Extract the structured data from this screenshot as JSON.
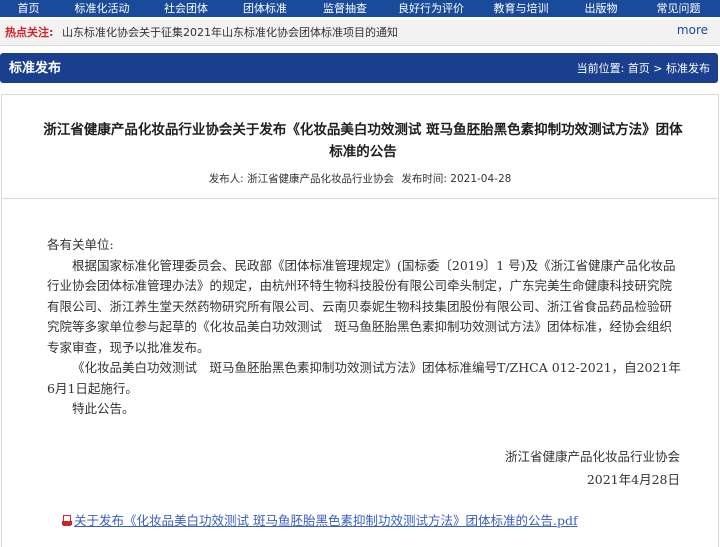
{
  "nav": [
    "首页",
    "标准化活动",
    "社会团体",
    "团体标准",
    "监督抽查",
    "良好行为评价",
    "教育与培训",
    "出版物",
    "常见问题"
  ],
  "hot": {
    "label": "热点关注:",
    "text": "山东标准化协会关于征集2021年山东标准化协会团体标准项目的通知",
    "more": "more"
  },
  "section": {
    "title": "标准发布",
    "breadcrumb": "当前位置: 首页 > 标准发布"
  },
  "article": {
    "title": "浙江省健康产品化妆品行业协会关于发布《化妆品美白功效测试 斑马鱼胚胎黑色素抑制功效测试方法》团体标准的公告",
    "publisher": "发布人: 浙江省健康产品化妆品行业协会",
    "date": "发布时间: 2021-04-28",
    "salutation": "各有关单位:",
    "paragraphs": [
      "根据国家标准化管理委员会、民政部《团体标准管理规定》(国标委〔2019〕1 号)及《浙江省健康产品化妆品行业协会团体标准管理办法》的规定，由杭州环特生物科技股份有限公司牵头制定，广东完美生命健康科技研究院有限公司、浙江养生堂天然药物研究所有限公司、云南贝泰妮生物科技集团股份有限公司、浙江省食品药品检验研究院等多家单位参与起草的《化妆品美白功效测试　斑马鱼胚胎黑色素抑制功效测试方法》团体标准，经协会组织专家审查，现予以批准发布。",
      "《化妆品美白功效测试　斑马鱼胚胎黑色素抑制功效测试方法》团体标准编号T/ZHCA 012-2021，自2021年6月1日起施行。",
      "特此公告。"
    ],
    "signature": "浙江省健康产品化妆品行业协会",
    "sign_date": "2021年4月28日",
    "attachment": "关于发布《化妆品美白功效测试 斑马鱼胚胎黑色素抑制功效测试方法》团体标准的公告.pdf"
  },
  "colors": {
    "nav_bg": "#1a4a9a",
    "section_bg": "#1a3f8f",
    "hot_label": "#d62222",
    "link": "#3b5fc4"
  }
}
